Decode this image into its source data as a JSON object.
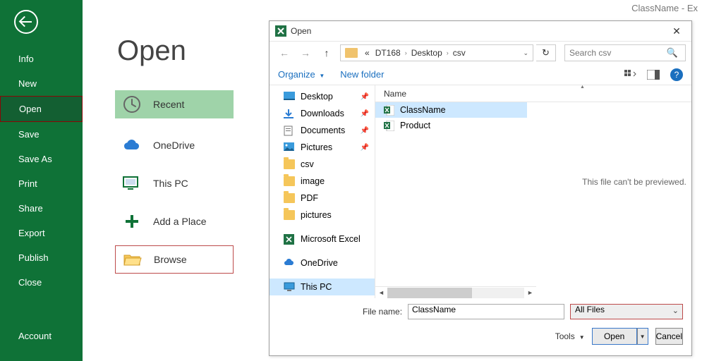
{
  "app_title": "ClassName - Ex",
  "page_title": "Open",
  "sidebar": {
    "items": [
      {
        "label": "Info"
      },
      {
        "label": "New"
      },
      {
        "label": "Open"
      },
      {
        "label": "Save"
      },
      {
        "label": "Save As"
      },
      {
        "label": "Print"
      },
      {
        "label": "Share"
      },
      {
        "label": "Export"
      },
      {
        "label": "Publish"
      },
      {
        "label": "Close"
      }
    ],
    "account": "Account"
  },
  "places": {
    "recent": "Recent",
    "onedrive": "OneDrive",
    "thispc": "This PC",
    "addplace": "Add a Place",
    "browse": "Browse"
  },
  "dialog": {
    "title": "Open",
    "breadcrumb": {
      "pre": "«",
      "p1": "DT168",
      "p2": "Desktop",
      "p3": "csv"
    },
    "search_placeholder": "Search csv",
    "toolbar": {
      "organize": "Organize",
      "newfolder": "New folder"
    },
    "tree": [
      {
        "label": "Desktop",
        "kind": "desktop",
        "pin": true
      },
      {
        "label": "Downloads",
        "kind": "downloads",
        "pin": true
      },
      {
        "label": "Documents",
        "kind": "documents",
        "pin": true
      },
      {
        "label": "Pictures",
        "kind": "pictures",
        "pin": true
      },
      {
        "label": "csv",
        "kind": "folder"
      },
      {
        "label": "image",
        "kind": "folder"
      },
      {
        "label": "PDF",
        "kind": "folder"
      },
      {
        "label": "pictures",
        "kind": "folder"
      },
      {
        "label": "Microsoft Excel",
        "kind": "excel"
      },
      {
        "label": "OneDrive",
        "kind": "onedrive"
      },
      {
        "label": "This PC",
        "kind": "thispc"
      }
    ],
    "columns": {
      "name": "Name"
    },
    "files": [
      {
        "name": "ClassName",
        "selected": true
      },
      {
        "name": "Product",
        "selected": false
      }
    ],
    "preview_msg": "This file can't be previewed.",
    "filename_label": "File name:",
    "filename_value": "ClassName",
    "filter": "All Files",
    "tools": "Tools",
    "open_btn": "Open",
    "cancel_btn": "Cancel"
  }
}
